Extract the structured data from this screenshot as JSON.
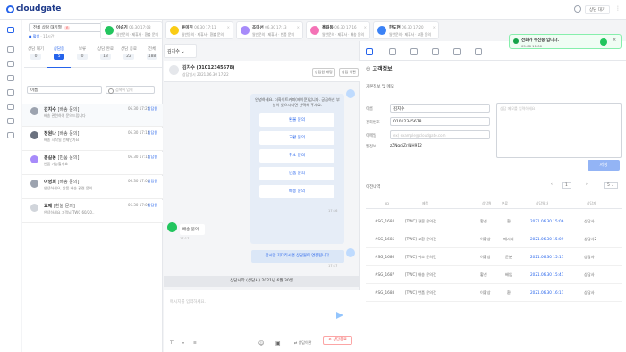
{
  "app": {
    "logo": "cloudgate",
    "status": "상담 대기"
  },
  "queue": {
    "label": "전체 상담 대기열",
    "count": "0"
  },
  "agent_status": {
    "state": "활성",
    "detail": "· 11시간"
  },
  "list_tabs": [
    {
      "label": "상담 대기",
      "count": "0"
    },
    {
      "label": "상담중",
      "count": "5"
    },
    {
      "label": "보류",
      "count": "0"
    },
    {
      "label": "상담 완료",
      "count": "13"
    },
    {
      "label": "상담 종료",
      "count": "22"
    },
    {
      "label": "전체",
      "count": "188"
    }
  ],
  "sort": {
    "value": "이름"
  },
  "search": {
    "placeholder": "검색어 입력"
  },
  "chats": [
    {
      "name": "김지수",
      "tag": "[배송 문의]",
      "preview": "배송 관련하여 문의드립니다",
      "time": "06.30 17:22",
      "agent": "상담원"
    },
    {
      "name": "정원나",
      "tag": "[배송 문의]",
      "preview": "배송 시작일 언제인가요",
      "time": "06.30 17:18",
      "agent": "상담원"
    },
    {
      "name": "홍길동",
      "tag": "[반품 문의]",
      "preview": "반품 가능할까요",
      "time": "06.30 17:14",
      "agent": "상담원"
    },
    {
      "name": "이영희",
      "tag": "[배송 문의]",
      "preview": "안녕하세요, 상품 배송 관련 문의",
      "time": "06.30 17:01",
      "agent": "상담원"
    },
    {
      "name": "교제",
      "tag": "[환불 문의]",
      "preview": "안녕하세요 고객님 TWC 60/20..",
      "time": "06.30 17:00",
      "agent": "상담원"
    }
  ],
  "top_cards": [
    {
      "name": "이승기",
      "time": "06.30 17:08",
      "sub": "일반문의 · 제휴사 · 환불 문의"
    },
    {
      "name": "윤미진",
      "time": "06.30 17:11",
      "sub": "일반문의 · 제휴사 · 환불 문의"
    },
    {
      "name": "조미선",
      "time": "06.30 17:13",
      "sub": "일반문의 · 제휴사 · 반품 문의"
    },
    {
      "name": "홍길동",
      "time": "06.30 17:16",
      "sub": "일반문의 · 제휴사 · 배송 문의"
    },
    {
      "name": "한도현",
      "time": "06.30 17:20",
      "sub": "일반문의 · 제휴사 · 교환 문의"
    }
  ],
  "chat": {
    "tab": "김지수",
    "title": "김지수 (01012345678)",
    "meta": "상담일시 2021.06.30 17:22",
    "btn1": "상담원 배정",
    "btn2": "상담 이관",
    "bot_text": "안녕하세요. 더화이트커피(제이쿤)입니다. 궁금하신 부분이 있으시다면 선택해 주세요.",
    "options": [
      "환불 문의",
      "교환 문의",
      "취소 문의",
      "반품 문의",
      "배송 문의"
    ],
    "bot_time": "17:16",
    "user_msg": "배송 문의",
    "user_time": "17:17",
    "sys_msg": "잠시만 기다리시면 상담원이 연결됩니다.",
    "sys_time": "17:17",
    "start_bar": "상담시작 (상담사) 2021년 6월 30일",
    "input_placeholder": "메시지를 입력하세요.",
    "btn_transfer": "상담이관",
    "btn_end": "상담종료"
  },
  "customer": {
    "title": "고객정보",
    "section": "기본정보 및 메모",
    "labels": [
      "이름",
      "전화번호",
      "이메일",
      "웹정보"
    ],
    "values": [
      "김지수",
      "01012345678",
      "",
      "zZNqdjZr/NH912"
    ],
    "email_placeholder": "ex) example@cloudgate.com",
    "memo_placeholder": "상담 메모를 입력하세요",
    "save": "저장"
  },
  "history": {
    "label": "이전내역",
    "page": "1",
    "page_size": "5",
    "columns": [
      "ID",
      "제목",
      "상담원",
      "분류",
      "상담일자",
      "상담자"
    ],
    "rows": [
      {
        "id": "#SG_1684",
        "title": "[TWC] 환불 문의건",
        "agent": "황신",
        "type": "환",
        "date": "2021.06.30 15:06",
        "who": "상담사"
      },
      {
        "id": "#SG_1685",
        "title": "[TWC] 교환 문의건",
        "agent": "이황상",
        "type": "메시지",
        "date": "2021.06.30 15:09",
        "who": "상담사2"
      },
      {
        "id": "#SG_1686",
        "title": "[TWC] 취소 문의건",
        "agent": "이황상",
        "type": "문분",
        "date": "2021.06.30 15:11",
        "who": "상담사"
      },
      {
        "id": "#SG_1687",
        "title": "[TWC] 배송 문의건",
        "agent": "황신",
        "type": "배입",
        "date": "2021.06.30 15:41",
        "who": "상담사"
      },
      {
        "id": "#SG_1688",
        "title": "[TWC] 반품 문의건",
        "agent": "이황상",
        "type": "환",
        "date": "2021.06.30 16:11",
        "who": "상담사"
      }
    ]
  },
  "toast": {
    "title": "전화가 수신중 입니다.",
    "time": "05:06 11:00"
  }
}
